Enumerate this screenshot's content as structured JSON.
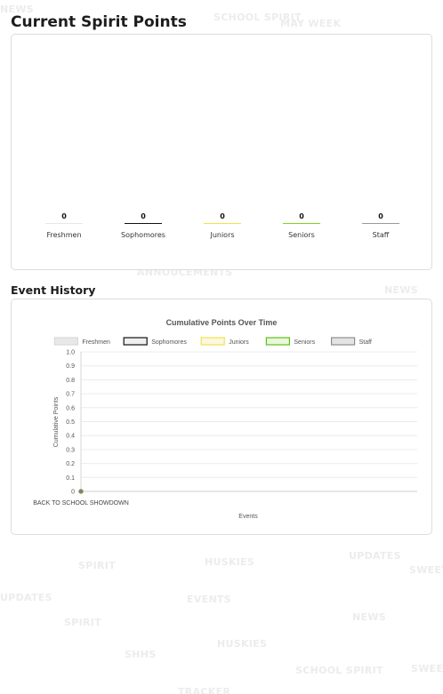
{
  "watermarks": [
    "NEWS",
    "SCHOOL SPIRIT",
    "MAY WEEK",
    "ANNOUCEMENTS",
    "NEWS",
    "SPIRIT",
    "HUSKIES",
    "UPDATES",
    "SWEET",
    "UPDATES",
    "EVENTS",
    "SPIRIT",
    "NEWS",
    "HUSKIES",
    "SHHS",
    "SCHOOL SPIRIT",
    "SWEET",
    "TRACKER"
  ],
  "current": {
    "title": "Current Spirit Points",
    "classes": [
      {
        "name": "Freshmen",
        "points": "0",
        "color": "#e6e6e6"
      },
      {
        "name": "Sophomores",
        "points": "0",
        "color": "#111111"
      },
      {
        "name": "Juniors",
        "points": "0",
        "color": "#f2e24a"
      },
      {
        "name": "Seniors",
        "points": "0",
        "color": "#7ed321"
      },
      {
        "name": "Staff",
        "points": "0",
        "color": "#9a9a9a"
      }
    ]
  },
  "history": {
    "title": "Event History"
  },
  "chart_data": {
    "type": "line",
    "title": "Cumulative Points Over Time",
    "xlabel": "Events",
    "ylabel": "Cumulative Points",
    "categories": [
      "BACK TO SCHOOL SHOWDOWN"
    ],
    "ylim": [
      0,
      1
    ],
    "yticks": [
      "1.0",
      "0.9",
      "0.8",
      "0.7",
      "0.6",
      "0.5",
      "0.4",
      "0.3",
      "0.2",
      "0.1",
      "0"
    ],
    "grid": true,
    "legend": "top",
    "series": [
      {
        "name": "Freshmen",
        "values": [
          0
        ],
        "fill": "#e8e8e8",
        "stroke": "#d8d8d8"
      },
      {
        "name": "Sophomores",
        "values": [
          0
        ],
        "fill": "#efefef",
        "stroke": "#111111"
      },
      {
        "name": "Juniors",
        "values": [
          0
        ],
        "fill": "#fbf8e0",
        "stroke": "#f2e24a"
      },
      {
        "name": "Seniors",
        "values": [
          0
        ],
        "fill": "#e9f7dc",
        "stroke": "#5cc21a"
      },
      {
        "name": "Staff",
        "values": [
          0
        ],
        "fill": "#e4e4e4",
        "stroke": "#8e8e8e"
      }
    ]
  }
}
